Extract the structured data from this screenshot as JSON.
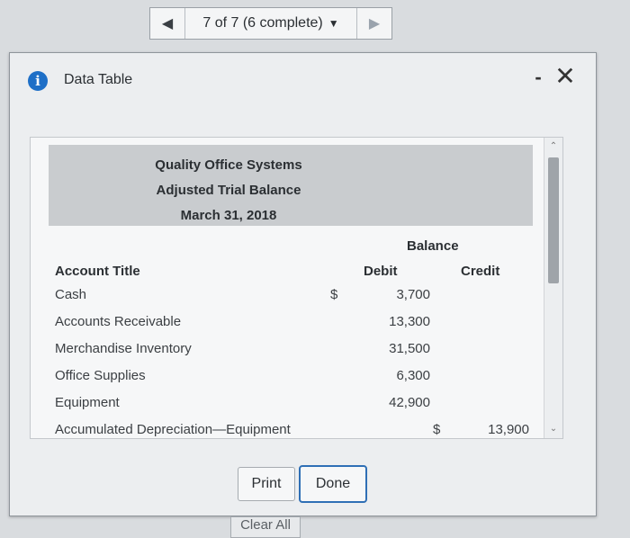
{
  "pager": {
    "prev_icon": "triangle-left-icon",
    "label": "7 of 7 (6 complete)",
    "dropdown_icon": "caret-down-icon",
    "next_icon": "triangle-right-icon"
  },
  "dialog": {
    "title": "Data Table",
    "info_icon_glyph": "i",
    "minimize_glyph": "-",
    "close_glyph": "✕"
  },
  "sheet": {
    "company": "Quality Office Systems",
    "report": "Adjusted Trial Balance",
    "date": "March 31, 2018",
    "balance_label": "Balance",
    "columns": {
      "account": "Account Title",
      "debit": "Debit",
      "credit": "Credit"
    },
    "rows": [
      {
        "account": "Cash",
        "debit_dollar": "$",
        "debit": "3,700",
        "credit_dollar": "",
        "credit": ""
      },
      {
        "account": "Accounts Receivable",
        "debit_dollar": "",
        "debit": "13,300",
        "credit_dollar": "",
        "credit": ""
      },
      {
        "account": "Merchandise Inventory",
        "debit_dollar": "",
        "debit": "31,500",
        "credit_dollar": "",
        "credit": ""
      },
      {
        "account": "Office Supplies",
        "debit_dollar": "",
        "debit": "6,300",
        "credit_dollar": "",
        "credit": ""
      },
      {
        "account": "Equipment",
        "debit_dollar": "",
        "debit": "42,900",
        "credit_dollar": "",
        "credit": ""
      },
      {
        "account": "Accumulated Depreciation—Equipment",
        "debit_dollar": "",
        "debit": "",
        "credit_dollar": "$",
        "credit": "13,900"
      }
    ]
  },
  "buttons": {
    "print": "Print",
    "done": "Done",
    "clear_all": "Clear All"
  }
}
